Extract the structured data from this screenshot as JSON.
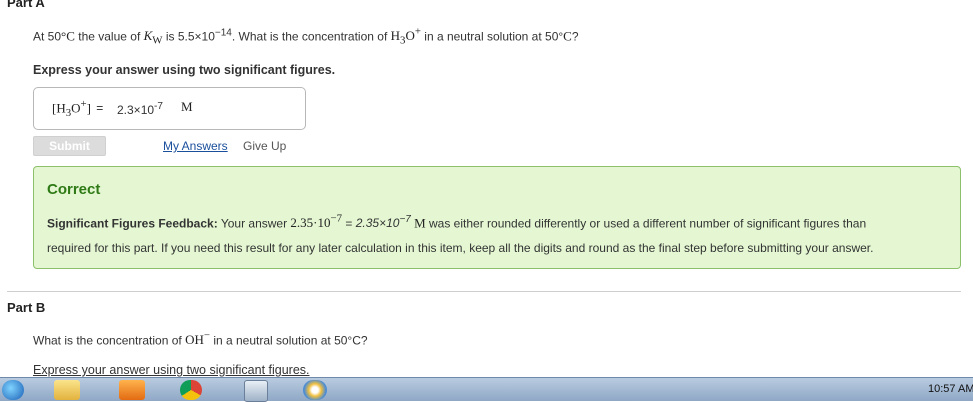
{
  "part_a": {
    "title": "Part A",
    "question_pre": "At 50",
    "question_deg": "°C",
    "question_mid": " the value of ",
    "kw": "K",
    "kw_sub": "W",
    "question_is": " is 5.5×10",
    "exp14": "−14",
    "question_post": ". What is the concentration of ",
    "h3o": "H",
    "h3o_sub": "3",
    "h3o_o": "O",
    "h3o_sup": "+",
    "question_end": " in a neutral solution at 50°",
    "question_c": "C",
    "question_q": "?",
    "instruction": "Express your answer using two significant figures.",
    "answer_label_open": "[H",
    "answer_label_sub": "3",
    "answer_label_o": "O",
    "answer_label_sup": "+",
    "answer_label_close": "]",
    "answer_eq": "=",
    "answer_value": "2.3×10",
    "answer_exp": "-7",
    "answer_unit": "M",
    "submit_label": "Submit",
    "my_answers_label": "My Answers",
    "give_up_label": "Give Up"
  },
  "feedback": {
    "title": "Correct",
    "label": "Significant Figures Feedback:",
    "text1": " Your answer ",
    "yours": "2.35·10",
    "yours_exp": "−7",
    "eq": " = ",
    "alt": "2.35×10",
    "alt_exp": "−7",
    "unit": " M",
    "text2": " was either rounded differently or used a different number of significant figures than",
    "line2": "required for this part. If you need this result for any later calculation in this item, keep all the digits and round as the final step before submitting your answer."
  },
  "part_b": {
    "title": "Part B",
    "question_pre": "What is the concentration of ",
    "oh": "OH",
    "oh_sup": "−",
    "question_post": "  in a neutral solution at 50°C?",
    "instruction": "Express your answer using two significant figures."
  },
  "taskbar": {
    "clock": "10:57 AM",
    "icons": [
      "windows-start-icon",
      "folder-icon",
      "media-player-icon",
      "chrome-icon",
      "calculator-icon",
      "paint-icon"
    ]
  },
  "colors": {
    "feedback_bg": "#e4f7d2",
    "feedback_border": "#8cc06b",
    "correct_green": "#2f7a16",
    "link_blue": "#1a4f9c"
  }
}
